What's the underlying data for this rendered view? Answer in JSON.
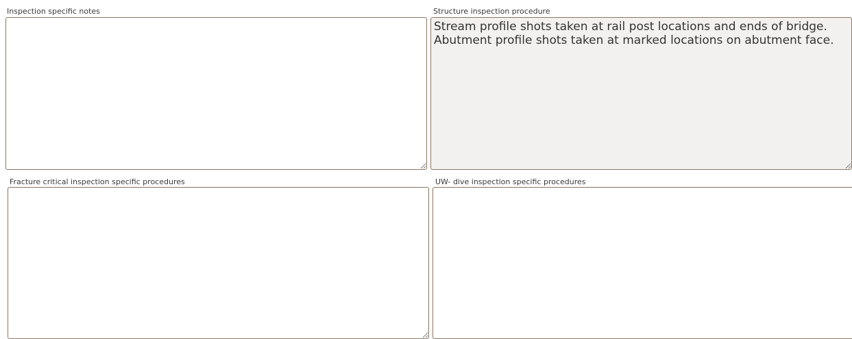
{
  "fields": {
    "inspection_notes": {
      "label": "Inspection specific notes",
      "value": ""
    },
    "structure_procedure": {
      "label": "Structure inspection procedure",
      "value": "Stream profile shots taken at rail post locations and ends of bridge. Abutment profile shots taken at marked locations on abutment face."
    },
    "fracture_critical": {
      "label": "Fracture critical inspection specific procedures",
      "value": ""
    },
    "uw_dive": {
      "label": "UW- dive inspection specific procedures",
      "value": ""
    }
  },
  "colors": {
    "border": "#8a7562",
    "readonly_bg": "#f3f1ef",
    "label_text": "#3a3a3a",
    "body_text": "#333333"
  }
}
